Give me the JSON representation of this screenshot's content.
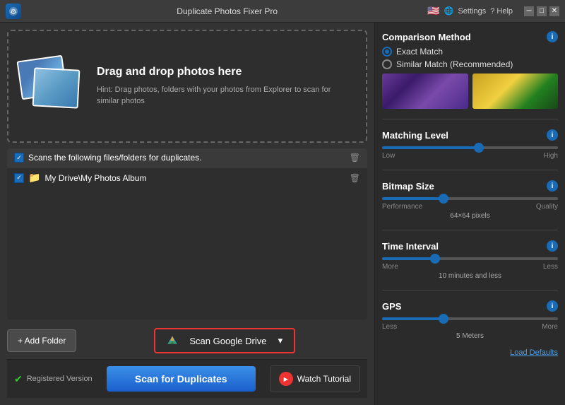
{
  "titleBar": {
    "title": "Duplicate Photos Fixer Pro",
    "settingsLabel": "Settings",
    "helpLabel": "? Help"
  },
  "dropZone": {
    "heading": "Drag and drop photos here",
    "hint": "Hint: Drag photos, folders with your photos from Explorer to scan for similar photos"
  },
  "foldersSection": {
    "headerLabel": "Scans the following files/folders for duplicates.",
    "folderItem": "My Drive\\My Photos Album"
  },
  "buttons": {
    "addFolder": "+ Add Folder",
    "scanGoogleDrive": "Scan Google Drive",
    "scanDuplicates": "Scan for Duplicates",
    "watchTutorial": "Watch Tutorial",
    "loadDefaults": "Load Defaults"
  },
  "statusBar": {
    "registeredVersion": "Registered Version"
  },
  "rightPanel": {
    "comparisonMethod": {
      "title": "Comparison Method",
      "exactMatch": "Exact Match",
      "similarMatch": "Similar Match (Recommended)"
    },
    "matchingLevel": {
      "title": "Matching Level",
      "lowLabel": "Low",
      "highLabel": "High",
      "thumbPosition": 55
    },
    "bitmapSize": {
      "title": "Bitmap Size",
      "performanceLabel": "Performance",
      "qualityLabel": "Quality",
      "centerLabel": "64×64 pixels",
      "thumbPosition": 35
    },
    "timeInterval": {
      "title": "Time Interval",
      "moreLabel": "More",
      "lessLabel": "Less",
      "centerLabel": "10 minutes and less",
      "thumbPosition": 30
    },
    "gps": {
      "title": "GPS",
      "lessLabel": "Less",
      "moreLabel": "More",
      "centerLabel": "5 Meters",
      "thumbPosition": 35
    }
  }
}
